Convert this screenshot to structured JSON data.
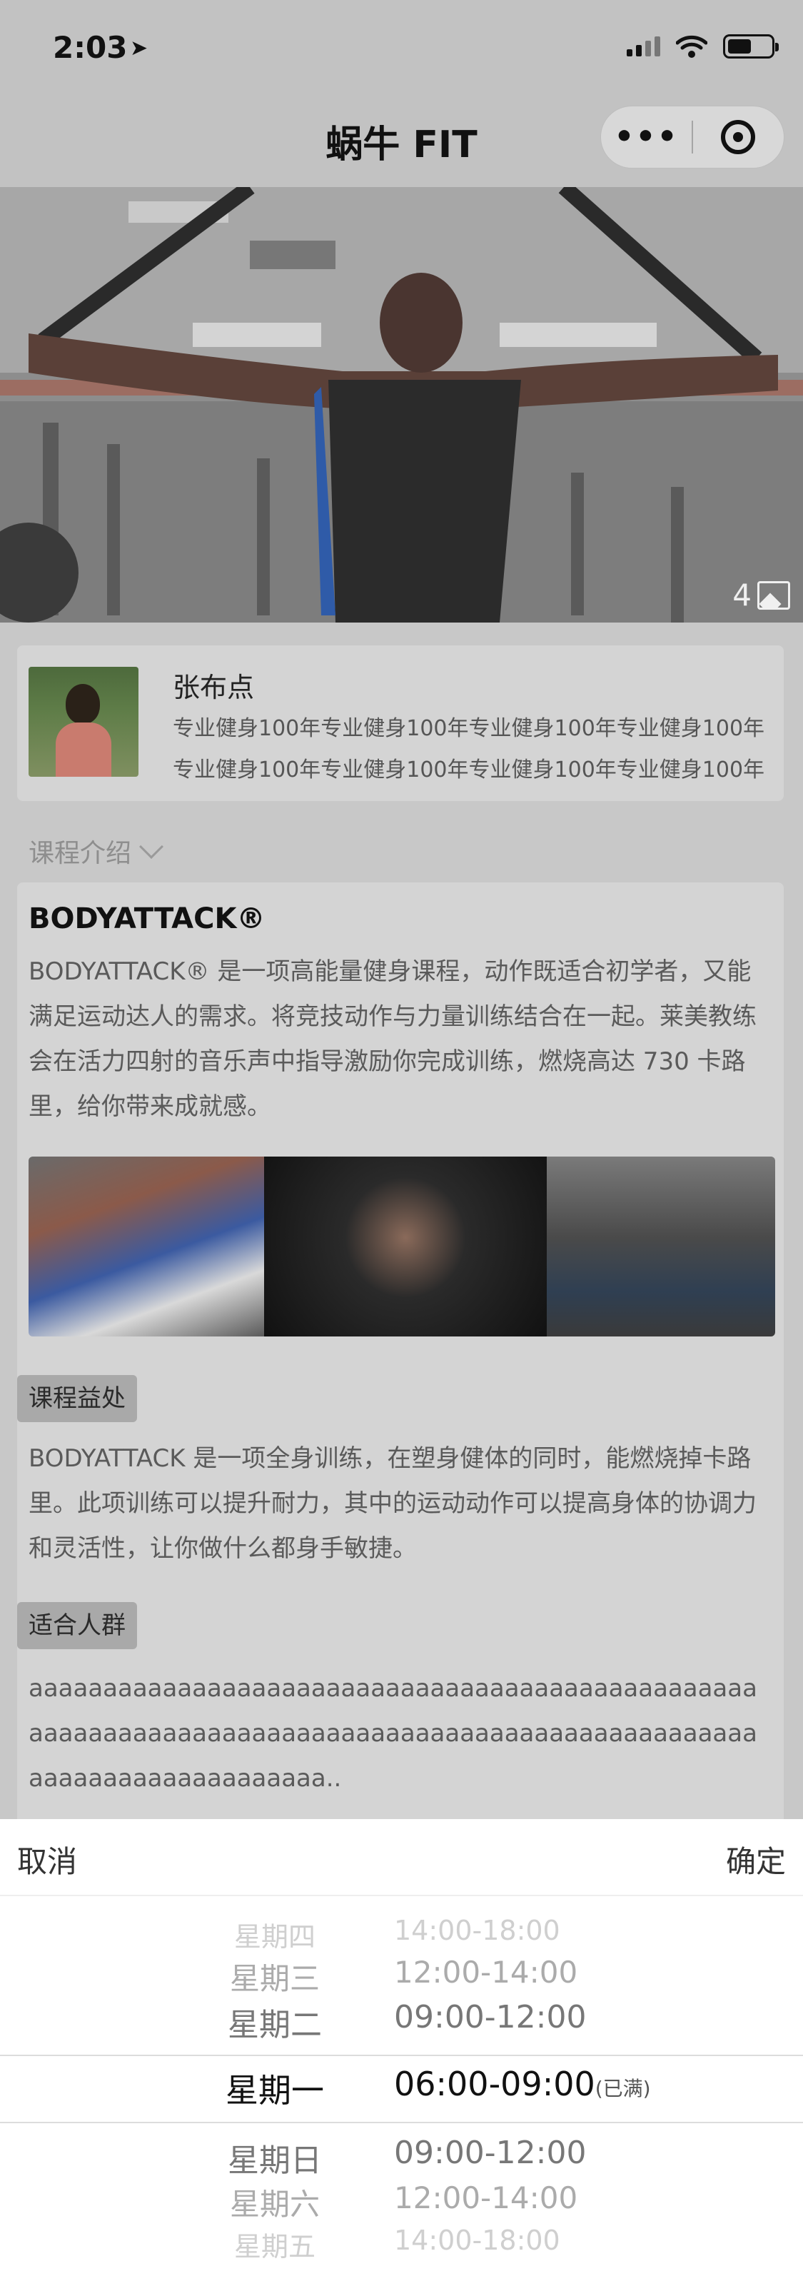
{
  "status_bar": {
    "time": "2:03"
  },
  "nav": {
    "title": "蜗牛 FIT",
    "more_glyph": "•••"
  },
  "hero": {
    "photo_count": "4"
  },
  "coach": {
    "name": "张布点",
    "description": "专业健身100年专业健身100年专业健身100年专业健身100年专业健身100年专业健身100年专业健身100年专业健身100年"
  },
  "section": {
    "label": "课程介绍"
  },
  "course": {
    "name": "BODYATTACK®",
    "intro": "BODYATTACK® 是一项高能量健身课程，动作既适合初学者，又能满足运动达人的需求。将竞技动作与力量训练结合在一起。莱美教练会在活力四射的音乐声中指导激励你完成训练，燃烧高达 730 卡路里，给你带来成就感。",
    "benefit_tag": "课程益处",
    "benefit": "BODYATTACK 是一项全身训练，在塑身健体的同时，能燃烧掉卡路里。此项训练可以提升耐力，其中的运动动作可以提高身体的协调力和灵活性，让你做什么都身手敏捷。",
    "crowd_tag": "适合人群",
    "crowd": "aaaaaaaaaaaaaaaaaaaaaaaaaaaaaaaaaaaaaaaaaaaaaaaaaaaaaaaaaaaaaaaaaaaaaaaaaaaaaaaaaaaaaaaaaaaaaaaaaaaaaaaaaaaaaaaaaaaaaa.."
  },
  "picker": {
    "cancel": "取消",
    "confirm": "确定",
    "rows": [
      {
        "day": "星期四",
        "time": "14:00-18:00",
        "note": ""
      },
      {
        "day": "星期三",
        "time": "12:00-14:00",
        "note": ""
      },
      {
        "day": "星期二",
        "time": "09:00-12:00",
        "note": ""
      },
      {
        "day": "星期一",
        "time": "06:00-09:00",
        "note": "(已满)"
      },
      {
        "day": "星期日",
        "time": "09:00-12:00",
        "note": ""
      },
      {
        "day": "星期六",
        "time": "12:00-14:00",
        "note": ""
      },
      {
        "day": "星期五",
        "time": "14:00-18:00",
        "note": ""
      }
    ],
    "selected_index": 3
  },
  "colors": {
    "overlay": "#c8c8c8",
    "picker_bg": "#ffffff",
    "text_dim": "#bdbdbd"
  }
}
